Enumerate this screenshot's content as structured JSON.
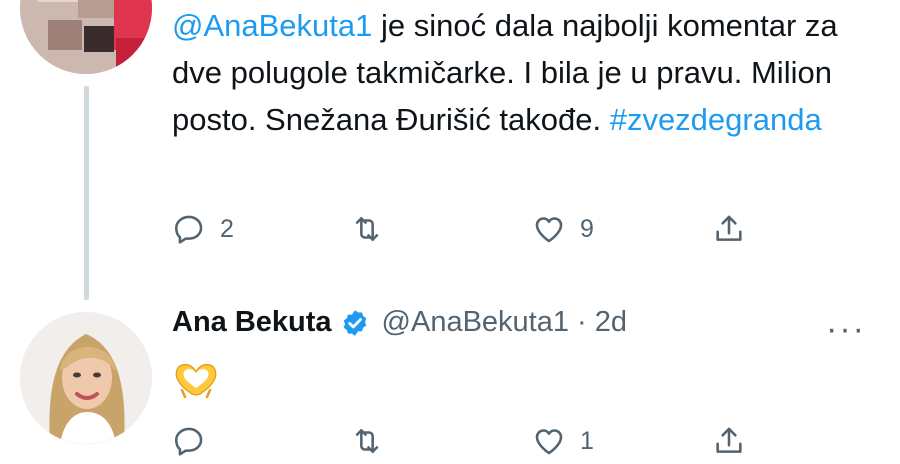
{
  "tweet": {
    "mention": "@AnaBekuta1",
    "text": " je sinoć dala najbolji komentar za dve polugole takmičarke. I bila je u pravu. Milion posto. Snežana Đurišić takođe. ",
    "hashtag": "#zvezdegranda",
    "replies": "2",
    "likes": "9"
  },
  "reply": {
    "name": "Ana Bekuta",
    "handle": "@AnaBekuta1 · 2d",
    "likes": "1"
  },
  "colors": {
    "link": "#1d9bf0",
    "muted": "#536471",
    "text": "#0f1419",
    "verified": "#1d9bf0"
  },
  "icons": [
    "reply-icon",
    "retweet-icon",
    "heart-icon",
    "share-icon",
    "verified-badge-icon",
    "more-icon",
    "heart-hands-emoji"
  ]
}
